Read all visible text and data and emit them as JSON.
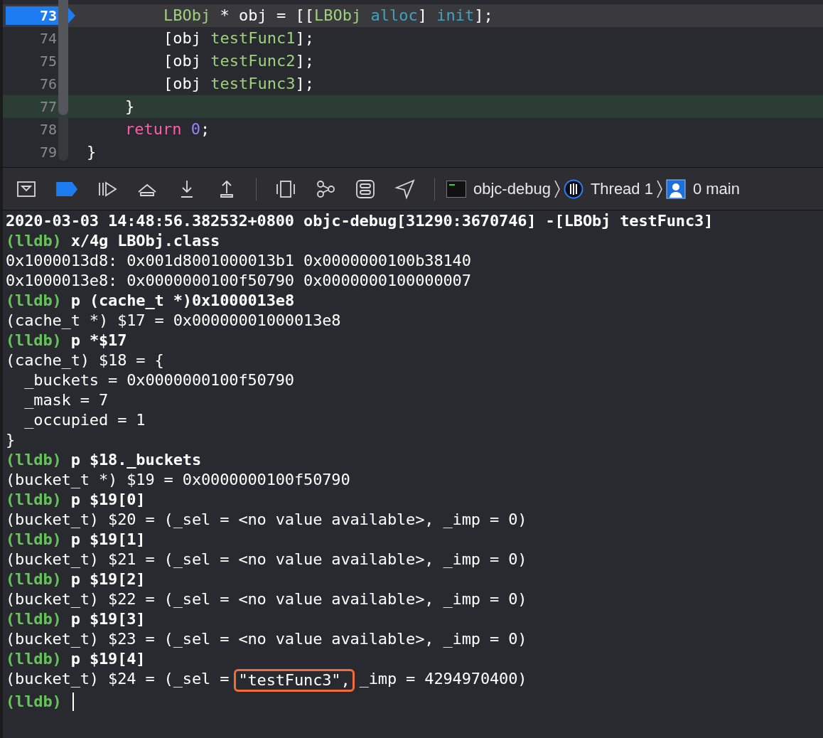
{
  "editor": {
    "lines": [
      {
        "number": "73",
        "kind": "inner",
        "current": true,
        "highlighted": false,
        "tokens": [
          {
            "kind": "type",
            "text": "LBObj"
          },
          {
            "kind": "plain",
            "text": " * obj = [["
          },
          {
            "kind": "type",
            "text": "LBObj"
          },
          {
            "kind": "method",
            "text": " alloc"
          },
          {
            "kind": "plain",
            "text": "] "
          },
          {
            "kind": "method",
            "text": "init"
          },
          {
            "kind": "plain",
            "text": "];"
          }
        ]
      },
      {
        "number": "74",
        "kind": "inner",
        "current": false,
        "highlighted": false,
        "tokens": [
          {
            "kind": "plain",
            "text": "[obj "
          },
          {
            "kind": "type",
            "text": "testFunc1"
          },
          {
            "kind": "plain",
            "text": "];"
          }
        ]
      },
      {
        "number": "75",
        "kind": "inner",
        "current": false,
        "highlighted": false,
        "tokens": [
          {
            "kind": "plain",
            "text": "[obj "
          },
          {
            "kind": "type",
            "text": "testFunc2"
          },
          {
            "kind": "plain",
            "text": "];"
          }
        ]
      },
      {
        "number": "76",
        "kind": "inner",
        "current": false,
        "highlighted": false,
        "tokens": [
          {
            "kind": "plain",
            "text": "[obj "
          },
          {
            "kind": "type",
            "text": "testFunc3"
          },
          {
            "kind": "plain",
            "text": "];"
          }
        ]
      },
      {
        "number": "77",
        "kind": "body",
        "current": false,
        "highlighted": true,
        "tokens": [
          {
            "kind": "plain",
            "text": "}"
          }
        ]
      },
      {
        "number": "78",
        "kind": "body",
        "current": false,
        "highlighted": false,
        "tokens": [
          {
            "kind": "keyword",
            "text": "return"
          },
          {
            "kind": "number",
            "text": " 0"
          },
          {
            "kind": "plain",
            "text": ";"
          }
        ]
      },
      {
        "number": "79",
        "kind": "outer",
        "current": false,
        "highlighted": false,
        "tokens": [
          {
            "kind": "plain",
            "text": "}"
          }
        ]
      }
    ]
  },
  "debug_bar": {
    "breakpoints_active": true,
    "breadcrumbs": [
      {
        "kind": "process",
        "label": "objc-debug"
      },
      {
        "kind": "thread",
        "label": "Thread 1"
      },
      {
        "kind": "frame",
        "label": "0 main"
      }
    ]
  },
  "console": {
    "lines": [
      {
        "kind": "log",
        "text": "2020-03-03 14:48:56.382532+0800 objc-debug[31290:3670746] -[LBObj testFunc3]"
      },
      {
        "kind": "command",
        "prompt": "(lldb)",
        "text": "x/4g LBObj.class"
      },
      {
        "kind": "output",
        "text": "0x1000013d8: 0x001d8001000013b1 0x0000000100b38140"
      },
      {
        "kind": "output",
        "text": "0x1000013e8: 0x0000000100f50790 0x0000000100000007"
      },
      {
        "kind": "command",
        "prompt": "(lldb)",
        "text": "p (cache_t *)0x1000013e8"
      },
      {
        "kind": "output",
        "text": "(cache_t *) $17 = 0x00000001000013e8"
      },
      {
        "kind": "command",
        "prompt": "(lldb)",
        "text": "p *$17"
      },
      {
        "kind": "output",
        "text": "(cache_t) $18 = {"
      },
      {
        "kind": "output",
        "text": "  _buckets = 0x0000000100f50790"
      },
      {
        "kind": "output",
        "text": "  _mask = 7"
      },
      {
        "kind": "output",
        "text": "  _occupied = 1"
      },
      {
        "kind": "output",
        "text": "}"
      },
      {
        "kind": "command",
        "prompt": "(lldb)",
        "text": "p $18._buckets"
      },
      {
        "kind": "output",
        "text": "(bucket_t *) $19 = 0x0000000100f50790"
      },
      {
        "kind": "command",
        "prompt": "(lldb)",
        "text": "p $19[0]"
      },
      {
        "kind": "output",
        "text": "(bucket_t) $20 = (_sel = <no value available>, _imp = 0)"
      },
      {
        "kind": "command",
        "prompt": "(lldb)",
        "text": "p $19[1]"
      },
      {
        "kind": "output",
        "text": "(bucket_t) $21 = (_sel = <no value available>, _imp = 0)"
      },
      {
        "kind": "command",
        "prompt": "(lldb)",
        "text": "p $19[2]"
      },
      {
        "kind": "output",
        "text": "(bucket_t) $22 = (_sel = <no value available>, _imp = 0)"
      },
      {
        "kind": "command",
        "prompt": "(lldb)",
        "text": "p $19[3]"
      },
      {
        "kind": "output",
        "text": "(bucket_t) $23 = (_sel = <no value available>, _imp = 0)"
      },
      {
        "kind": "command",
        "prompt": "(lldb)",
        "text": "p $19[4]"
      },
      {
        "kind": "annotated",
        "before": "(bucket_t) $24 = (_sel = ",
        "boxed": "\"testFunc3\",",
        "after": " _imp = 4294970400)"
      },
      {
        "kind": "input",
        "prompt": "(lldb)"
      }
    ]
  }
}
